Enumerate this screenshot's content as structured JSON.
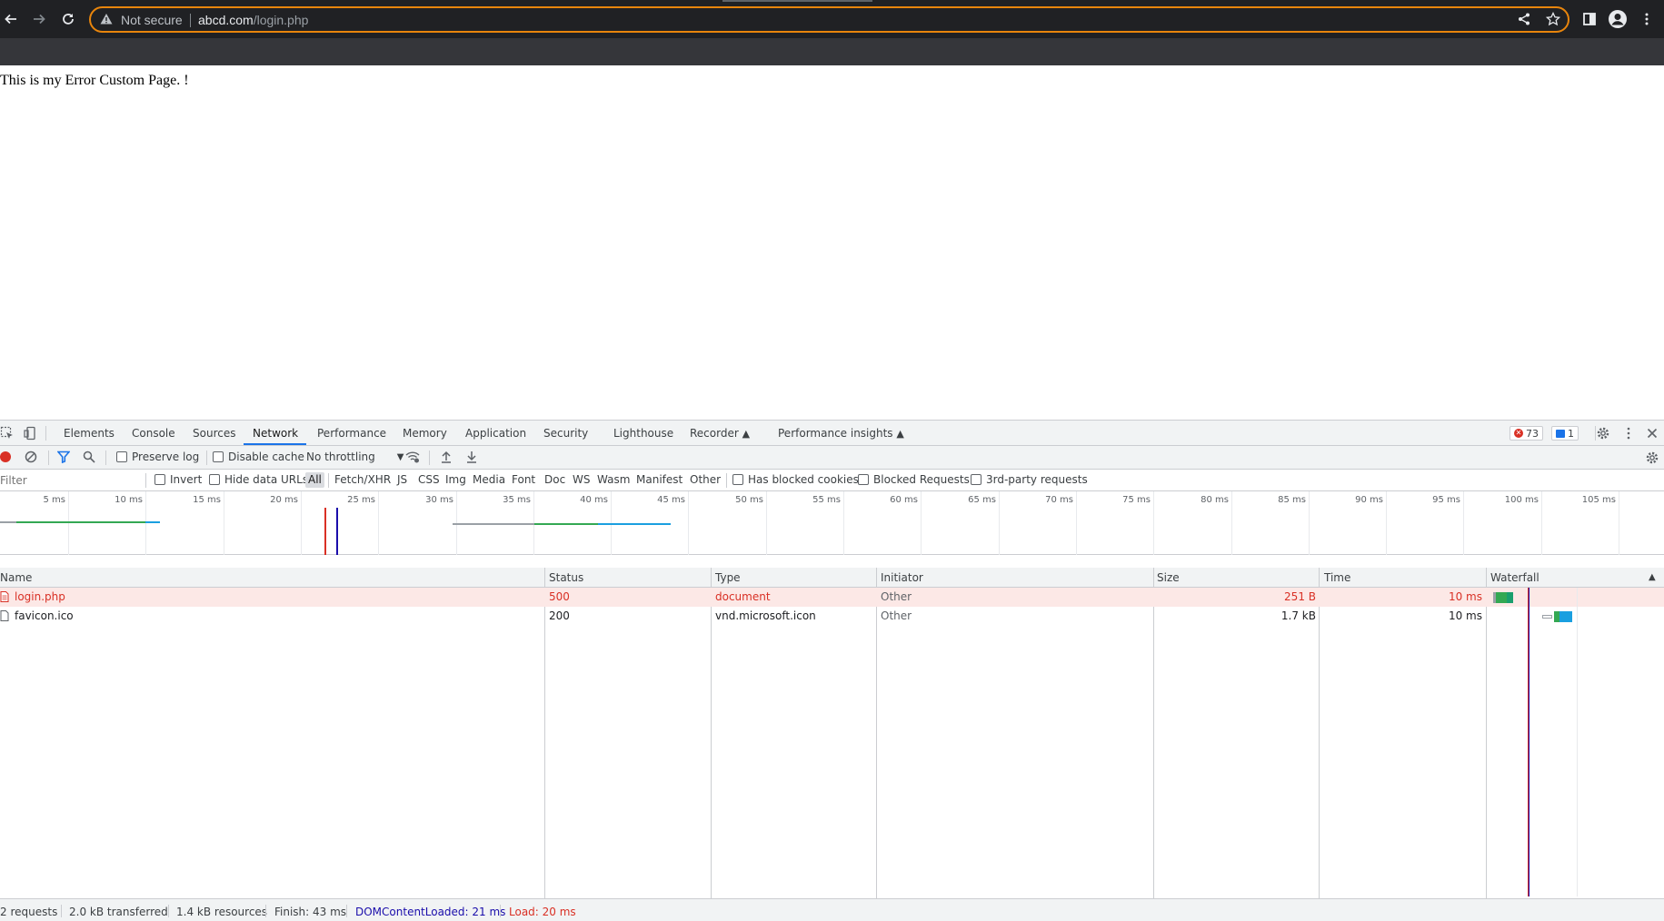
{
  "browser": {
    "security_label": "Not secure",
    "url_host": "abcd.com",
    "url_path": "/login.php"
  },
  "page": {
    "text": "This is my Error Custom Page. !"
  },
  "devtools": {
    "tabs": [
      "Elements",
      "Console",
      "Sources",
      "Network",
      "Performance",
      "Memory",
      "Application",
      "Security",
      "Lighthouse",
      "Recorder",
      "Performance insights"
    ],
    "active_tab": "Network",
    "error_count": "73",
    "message_count": "1",
    "toolbar": {
      "preserve_log": "Preserve log",
      "disable_cache": "Disable cache",
      "throttling": "No throttling"
    },
    "filter": {
      "placeholder": "Filter",
      "invert": "Invert",
      "hide_data_urls": "Hide data URLs",
      "types": [
        "All",
        "Fetch/XHR",
        "JS",
        "CSS",
        "Img",
        "Media",
        "Font",
        "Doc",
        "WS",
        "Wasm",
        "Manifest",
        "Other"
      ],
      "has_blocked_cookies": "Has blocked cookies",
      "blocked_requests": "Blocked Requests",
      "third_party": "3rd-party requests"
    },
    "overview_ticks": [
      "5 ms",
      "10 ms",
      "15 ms",
      "20 ms",
      "25 ms",
      "30 ms",
      "35 ms",
      "40 ms",
      "45 ms",
      "50 ms",
      "55 ms",
      "60 ms",
      "65 ms",
      "70 ms",
      "75 ms",
      "80 ms",
      "85 ms",
      "90 ms",
      "95 ms",
      "100 ms",
      "105 ms"
    ],
    "columns": {
      "name": "Name",
      "status": "Status",
      "type": "Type",
      "initiator": "Initiator",
      "size": "Size",
      "time": "Time",
      "waterfall": "Waterfall"
    },
    "requests": [
      {
        "name": "login.php",
        "status": "500",
        "type": "document",
        "initiator": "Other",
        "size": "251 B",
        "time": "10 ms"
      },
      {
        "name": "favicon.ico",
        "status": "200",
        "type": "vnd.microsoft.icon",
        "initiator": "Other",
        "size": "1.7 kB",
        "time": "10 ms"
      }
    ],
    "summary": {
      "requests": "2 requests",
      "transferred": "2.0 kB transferred",
      "resources": "1.4 kB resources",
      "finish": "Finish: 43 ms",
      "dom_content_loaded": "DOMContentLoaded: 21 ms",
      "load": "Load: 20 ms"
    },
    "colors": {
      "accent": "#1a73e8",
      "error": "#d93025",
      "dcl_line": "#1a0dab",
      "load_line": "#d93025"
    }
  }
}
